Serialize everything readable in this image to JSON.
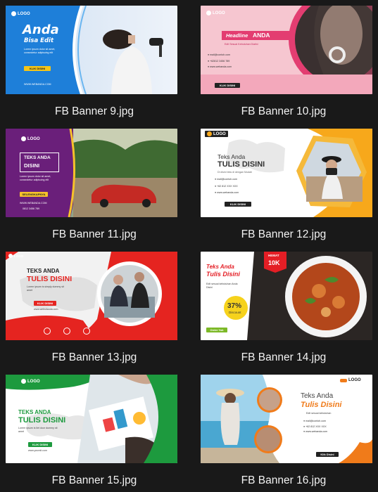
{
  "thumbnails": [
    {
      "filename": "FB Banner 9.jpg",
      "logo": "LOGO",
      "headline": "Anda",
      "subheadline": "Bisa Edit",
      "body": "Lorem ipsum dolor sit amet, consectetur adipiscing elit",
      "button": "KLIK DISINI",
      "url": "WWW.WEBANDA.COM"
    },
    {
      "filename": "FB Banner 10.jpg",
      "logo": "LOGO",
      "headline_a": "Headline",
      "headline_b": "ANDA",
      "subheadline": "Edit Sesuai Kebutuhan Diatini",
      "contacts": [
        "mail@contoh.com",
        "+62812 3456 789",
        "www.webanda.com"
      ],
      "button": "KLIK DISINI"
    },
    {
      "filename": "FB Banner 11.jpg",
      "logo": "LOGO",
      "headline_a": "TEKS ANDA",
      "headline_b": "DISINI",
      "body": "Lorem ipsum dolor sit amet, consectetur adipiscing elit",
      "button": "SELENGKAPNYA",
      "url": "WWW.WEBANDA.COM",
      "phone": "0812 3456 789"
    },
    {
      "filename": "FB Banner 12.jpg",
      "logo": "LOGO",
      "headline_a": "Teks Anda",
      "headline_b": "TULIS DISINI",
      "subheadline": "Di disini teks di dengan Mudah",
      "contacts": [
        "mail@contoh.com",
        "+62 812 XXX XXX",
        "www.webanda.com"
      ],
      "button": "KLIK DISINI"
    },
    {
      "filename": "FB Banner 13.jpg",
      "logo": "LOGO",
      "headline_a": "TEKS ANDA",
      "headline_b": "TULIS DISINI",
      "body": "Lorem ipsum is simply dummy sit amet",
      "button": "KLIK DISINI",
      "url": "www.websitanda.com"
    },
    {
      "filename": "FB Banner 14.jpg",
      "headline_a": "Teks Anda",
      "headline_b": "Tulis Disini",
      "body": "Edit sesuai kebutuhan Anda Disini",
      "badge_top": "HEMAT",
      "badge_value": "10K",
      "discount_value": "37%",
      "discount_label": "Discount",
      "button": "Order Yuk"
    },
    {
      "filename": "FB Banner 15.jpg",
      "logo": "LOGO",
      "headline_a": "TEKS ANDA",
      "headline_b": "TULIS DISINI",
      "body": "Lorem ipsum is llet door dummy sit amet",
      "button": "KLIK DISINI",
      "url": "www.yoursit.com"
    },
    {
      "filename": "FB Banner 16.jpg",
      "logo": "LOGO",
      "headline_a": "Teks Anda",
      "headline_b": "Tulis Disini",
      "subheadline": "Edit sesuai kebutuhan",
      "contacts": [
        "mail@contoh.com",
        "+62 812 XXX XXX",
        "www.webanda.com"
      ],
      "button": "Klik Disini"
    }
  ]
}
